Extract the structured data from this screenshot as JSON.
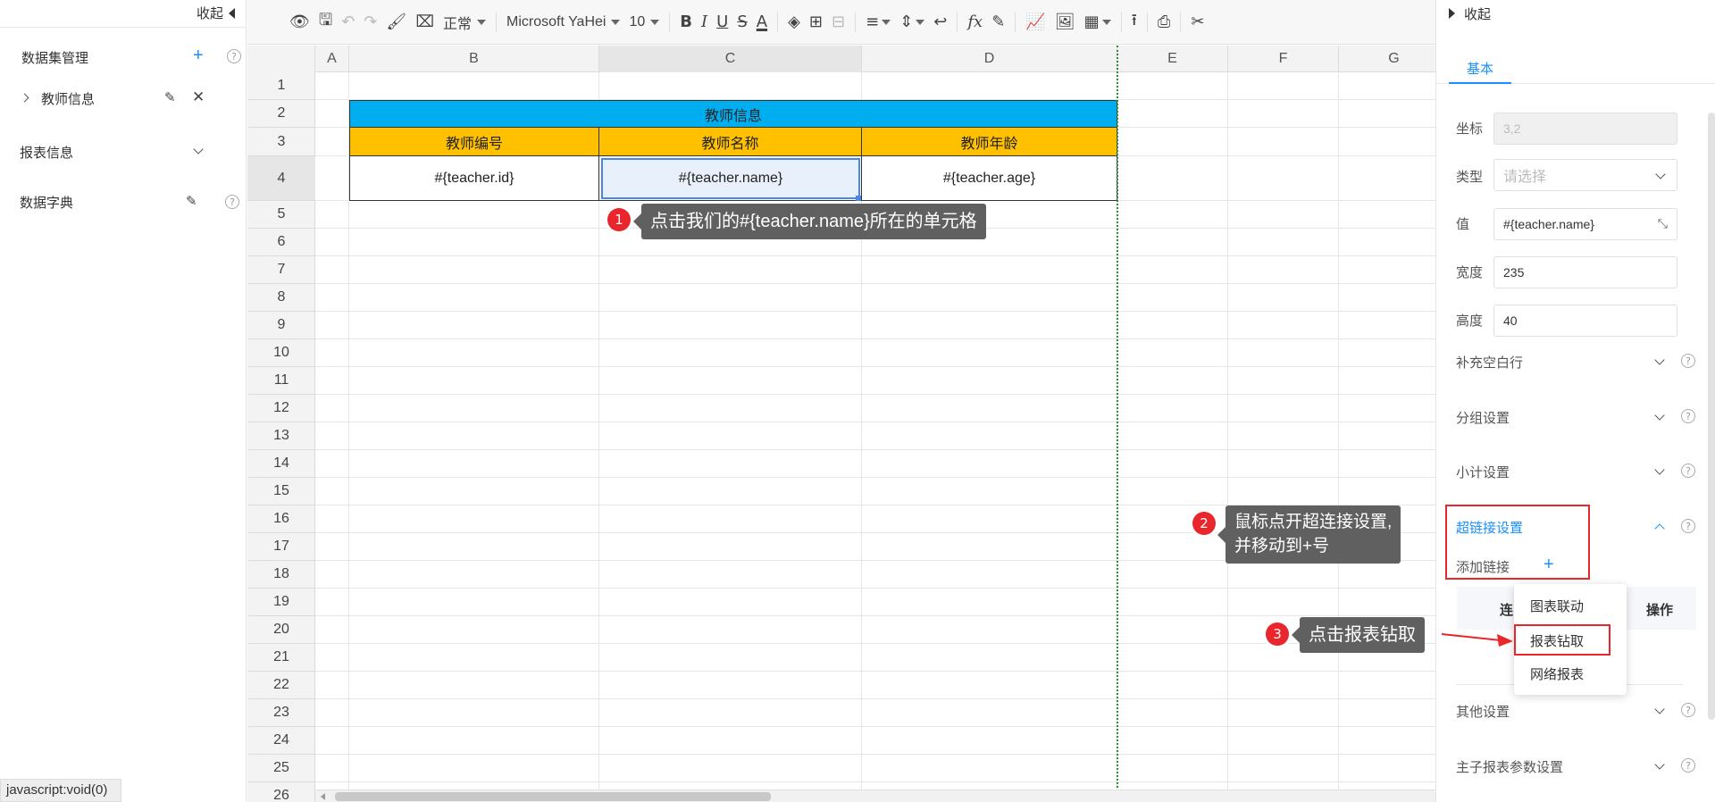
{
  "left_panel": {
    "collapse_label": "收起",
    "dataset_title": "数据集管理",
    "dataset_item": "教师信息",
    "report_info": "报表信息",
    "data_dictionary": "数据字典"
  },
  "status_bar": "javascript:void(0)",
  "toolbar": {
    "style_select": "正常",
    "font_select": "Microsoft YaHei",
    "size_select": "10"
  },
  "sheet": {
    "columns": [
      "A",
      "B",
      "C",
      "D",
      "E",
      "F",
      "G"
    ],
    "rows": [
      "1",
      "2",
      "3",
      "4",
      "5",
      "6",
      "7",
      "8",
      "9",
      "10",
      "11",
      "12",
      "13",
      "14",
      "15",
      "16",
      "17",
      "18",
      "19",
      "20",
      "21",
      "22",
      "23",
      "24",
      "25",
      "26"
    ],
    "title_cell": "教师信息",
    "header_cells": [
      "教师编号",
      "教师名称",
      "教师年龄"
    ],
    "data_cells": [
      "#{teacher.id}",
      "#{teacher.name}",
      "#{teacher.age}"
    ],
    "colors": {
      "title_bg": "#00aeef",
      "header_bg": "#ffc000",
      "selected_bg": "#e8f0fb",
      "selected_border": "#4a86e8"
    }
  },
  "right_panel": {
    "collapse_label": "收起",
    "tab_basic": "基本",
    "fields": {
      "coord_label": "坐标",
      "coord_value": "3,2",
      "type_label": "类型",
      "type_placeholder": "请选择",
      "value_label": "值",
      "value_value": "#{teacher.name}",
      "width_label": "宽度",
      "width_value": "235",
      "height_label": "高度",
      "height_value": "40"
    },
    "sections": {
      "fill_blank": "补充空白行",
      "group": "分组设置",
      "subtotal": "小计设置",
      "hyperlink": "超链接设置",
      "add_link": "添加链接",
      "other": "其他设置",
      "master_sub": "主子报表参数设置"
    },
    "table_cols": [
      "连",
      "操作"
    ],
    "menu_items": [
      "图表联动",
      "报表钻取",
      "网络报表"
    ]
  },
  "annotations": [
    {
      "num": "1",
      "text": "点击我们的#{teacher.name}所在的单元格"
    },
    {
      "num": "2",
      "line1": "鼠标点开超连接设置,",
      "line2": "并移动到+号"
    },
    {
      "num": "3",
      "text": "点击报表钻取"
    }
  ],
  "accent_color": "#1890ff",
  "highlight_color": "#e8262b"
}
